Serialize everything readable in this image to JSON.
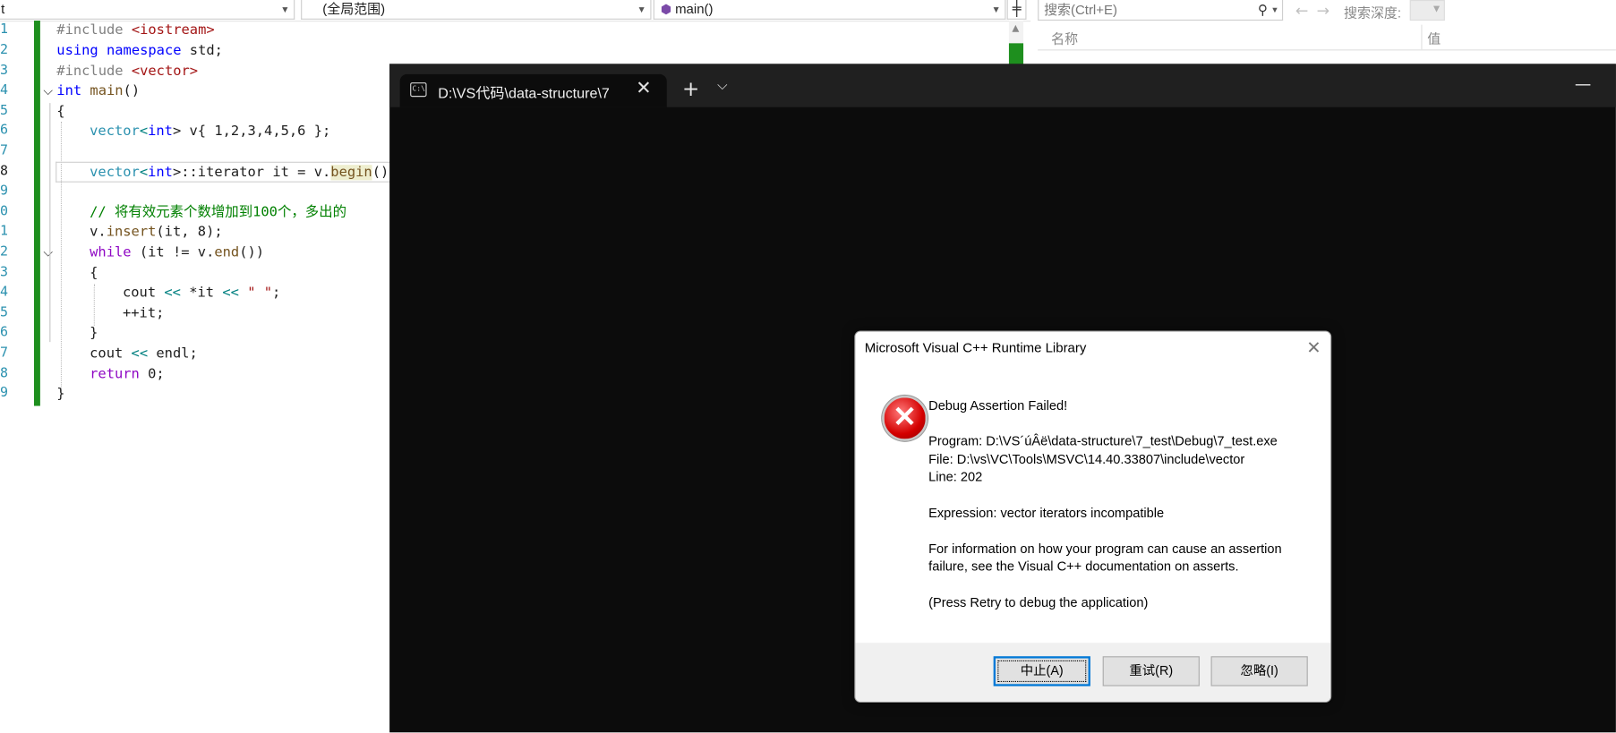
{
  "editor": {
    "nav": {
      "project_fragment": "t",
      "scope": "(全局范围)",
      "member": "main()"
    },
    "line_numbers": [
      "1",
      "2",
      "3",
      "4",
      "5",
      "6",
      "7",
      "8",
      "9",
      "0",
      "1",
      "2",
      "3",
      "4",
      "5",
      "6",
      "7",
      "8",
      "9"
    ],
    "code": {
      "l1_a": "#include ",
      "l1_b": "<iostream>",
      "l2_a": "using",
      "l2_b": " namespace",
      "l2_c": " std;",
      "l3_a": "#include ",
      "l3_b": "<vector>",
      "l4_a": "int",
      "l4_b": " main",
      "l4_c": "()",
      "l5": "{",
      "l6_a": "vector",
      "l6_b": "<",
      "l6_c": "int",
      "l6_d": "> v{ 1,2,3,4,5,6 };",
      "l8_a": "vector",
      "l8_b": "<",
      "l8_c": "int",
      "l8_d": ">::iterator it = v.",
      "l8_e": "begin",
      "l8_f": "()",
      "l10": "// 将有效元素个数增加到100个，多出的",
      "l11_a": "v.",
      "l11_b": "insert",
      "l11_c": "(it, 8);",
      "l12_a": "while",
      "l12_b": " (it != v.",
      "l12_c": "end",
      "l12_d": "())",
      "l13": "{",
      "l14_a": "cout ",
      "l14_b": "<<",
      "l14_c": " *it ",
      "l14_d": "<<",
      "l14_e": " \" \"",
      "l14_f": ";",
      "l15": "++it;",
      "l16": "}",
      "l17_a": "cout ",
      "l17_b": "<<",
      "l17_c": " endl;",
      "l18_a": "return",
      "l18_b": " 0;",
      "l19": "}"
    }
  },
  "debug_panel": {
    "search_placeholder": "搜索(Ctrl+E)",
    "search_depth_label": "搜索深度:",
    "col_name": "名称",
    "col_value": "值"
  },
  "terminal": {
    "tab_title": "D:\\VS代码\\data-structure\\7",
    "tab_icon_text": "C:\\",
    "new_tab_icon": "+",
    "dropdown_icon": "chevron-down",
    "minimize_icon": "—"
  },
  "dialog": {
    "title": "Microsoft Visual C++ Runtime Library",
    "heading": "Debug Assertion Failed!",
    "program": "Program: D:\\VS´úÂë\\data-structure\\7_test\\Debug\\7_test.exe",
    "file": "File: D:\\vs\\VC\\Tools\\MSVC\\14.40.33807\\include\\vector",
    "line": "Line: 202",
    "expression": "Expression: vector iterators incompatible",
    "info_1": "For information on how your program can cause an assertion",
    "info_2": "failure, see the Visual C++ documentation on asserts.",
    "press_retry": "(Press Retry to debug the application)",
    "buttons": {
      "abort": "中止(A)",
      "retry": "重试(R)",
      "ignore": "忽略(I)"
    }
  }
}
